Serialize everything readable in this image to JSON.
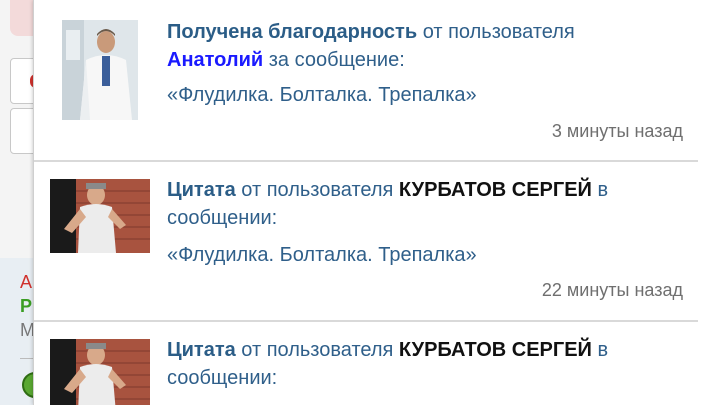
{
  "background": {
    "letters": [
      "А",
      "Р",
      "М"
    ]
  },
  "notifications": [
    {
      "action": "Получена благодарность",
      "from_text": " от пользователя ",
      "user": "Анатолий",
      "tail": " за сообщение:",
      "thread": "«Флудилка. Болталка. Трепалка»",
      "time": "3 минуты назад"
    },
    {
      "action": "Цитата",
      "from_text": " от пользователя ",
      "user": "КУРБАТОВ СЕРГЕЙ",
      "tail": " в сообщении:",
      "thread": "«Флудилка. Болталка. Трепалка»",
      "time": "22 минуты назад"
    },
    {
      "action": "Цитата",
      "from_text": " от пользователя ",
      "user": "КУРБАТОВ СЕРГЕЙ",
      "tail": " в сообщении:"
    }
  ]
}
